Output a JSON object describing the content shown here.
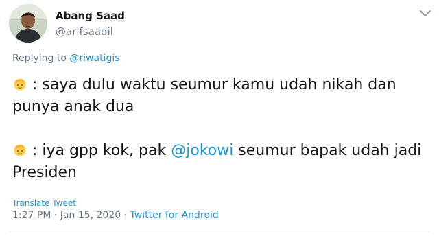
{
  "user": {
    "name": "Abang Saad",
    "handle": "@arifsaadil"
  },
  "reply": {
    "prefix": "Replying to ",
    "mention": "@riwatigis"
  },
  "tweet": {
    "line1_text": " : saya dulu waktu seumur kamu udah nikah dan punya anak dua",
    "line2_before": " : iya gpp kok, pak ",
    "line2_mention": "@jokowi",
    "line2_after": " seumur bapak udah jadi Presiden",
    "emoji": "person-emoji"
  },
  "translate_label": "Translate Tweet",
  "meta": {
    "time": "1:27 PM",
    "separator1": " · ",
    "date": "Jan 15, 2020",
    "separator2": " · ",
    "source": "Twitter for Android"
  },
  "colors": {
    "link": "#1b95e0",
    "secondary": "#657786",
    "text": "#14171a",
    "emoji": "#ffcc4d"
  },
  "icons": [
    "avatar-photo",
    "person-emoji",
    "chevron-down-icon"
  ]
}
